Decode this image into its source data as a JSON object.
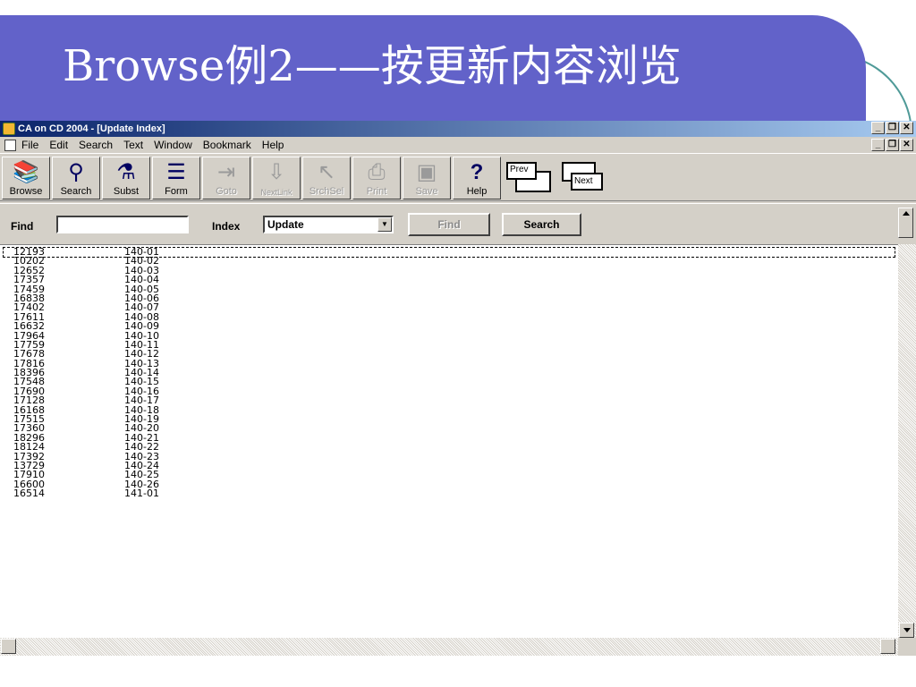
{
  "slide": {
    "title": "Browse例2——按更新内容浏览",
    "banner_color": "#6262c9"
  },
  "window": {
    "title": "CA on CD 2004 - [Update Index]",
    "controls": [
      "_",
      "❐",
      "✕"
    ]
  },
  "menu": {
    "items": [
      "File",
      "Edit",
      "Search",
      "Text",
      "Window",
      "Bookmark",
      "Help"
    ]
  },
  "toolbar": {
    "buttons": [
      {
        "label": "Browse",
        "icon": "books-icon",
        "enabled": true
      },
      {
        "label": "Search",
        "icon": "magnifier-icon",
        "enabled": true
      },
      {
        "label": "Subst",
        "icon": "flask-icon",
        "enabled": true
      },
      {
        "label": "Form",
        "icon": "beaker-icon",
        "enabled": true
      },
      {
        "label": "Goto",
        "icon": "goto-icon",
        "enabled": false
      },
      {
        "label": "NextLink",
        "icon": "nextlink-icon",
        "enabled": false
      },
      {
        "label": "SrchSel",
        "icon": "search-selection-icon",
        "enabled": false
      },
      {
        "label": "Print",
        "icon": "printer-icon",
        "enabled": false
      },
      {
        "label": "Save",
        "icon": "floppy-icon",
        "enabled": false
      },
      {
        "label": "Help",
        "icon": "question-icon",
        "enabled": true
      }
    ],
    "prev_label": "Prev",
    "next_label": "Next"
  },
  "findbar": {
    "find_label": "Find",
    "find_value": "",
    "index_label": "Index",
    "index_value": "Update",
    "find_button": "Find",
    "search_button": "Search"
  },
  "list": {
    "rows": [
      [
        "12193",
        "140-01"
      ],
      [
        "10202",
        "140-02"
      ],
      [
        "12652",
        "140-03"
      ],
      [
        "17357",
        "140-04"
      ],
      [
        "17459",
        "140-05"
      ],
      [
        "16838",
        "140-06"
      ],
      [
        "17402",
        "140-07"
      ],
      [
        "17611",
        "140-08"
      ],
      [
        "16632",
        "140-09"
      ],
      [
        "17964",
        "140-10"
      ],
      [
        "17759",
        "140-11"
      ],
      [
        "17678",
        "140-12"
      ],
      [
        "17816",
        "140-13"
      ],
      [
        "18396",
        "140-14"
      ],
      [
        "17548",
        "140-15"
      ],
      [
        "17690",
        "140-16"
      ],
      [
        "17128",
        "140-17"
      ],
      [
        "16168",
        "140-18"
      ],
      [
        "17515",
        "140-19"
      ],
      [
        "17360",
        "140-20"
      ],
      [
        "18296",
        "140-21"
      ],
      [
        "18124",
        "140-22"
      ],
      [
        "17392",
        "140-23"
      ],
      [
        "13729",
        "140-24"
      ],
      [
        "17910",
        "140-25"
      ],
      [
        "16600",
        "140-26"
      ],
      [
        "16514",
        "141-01"
      ]
    ],
    "selected_index": 0
  }
}
